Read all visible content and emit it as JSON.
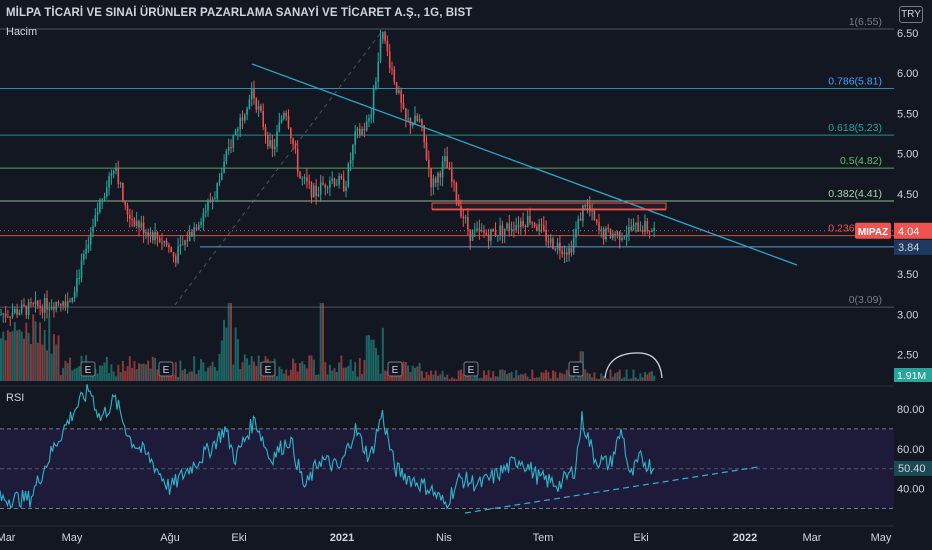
{
  "header": {
    "title": "MİLPA TİCARİ VE SINAİ ÜRÜNLER PAZARLAMA SANAYİ VE TİCARET A.Ş., 1G, BIST",
    "volume_label": "Hacim",
    "currency": "TRY"
  },
  "rsi": {
    "label": "RSI",
    "value": "50.40",
    "ticks": [
      "80.00",
      "60.00",
      "40.00"
    ]
  },
  "chart_data": {
    "type": "candlestick",
    "price_ticks": [
      "6.50",
      "6.00",
      "5.50",
      "5.00",
      "4.50",
      "4.00",
      "3.50",
      "3.00",
      "2.50"
    ],
    "x_ticks": [
      "Mar",
      "May",
      "Ağu",
      "Eki",
      "2021",
      "Nis",
      "Tem",
      "Eki",
      "2022",
      "Mar",
      "May"
    ],
    "fib_levels": [
      {
        "label": "1(6.55)",
        "value": 6.55
      },
      {
        "label": "0.786(5.81)",
        "value": 5.81
      },
      {
        "label": "0.618(5.23)",
        "value": 5.23
      },
      {
        "label": "0.5(4.82)",
        "value": 4.82
      },
      {
        "label": "0.382(4.41)",
        "value": 4.41
      },
      {
        "label": "0.236(3.98)",
        "value": 3.98
      },
      {
        "label": "0(3.09)",
        "value": 3.09
      }
    ],
    "symbol": "MIPAZ",
    "last_price": "4.04",
    "level_label": "3.84",
    "volume_last": "1.91M",
    "earnings_marker": "E"
  },
  "colors": {
    "background": "#131722",
    "up": "#26a69a",
    "down": "#ef5350",
    "trendline": "#2fa4c7",
    "rsi": "#2fb5c9",
    "rsi_band": "#1e1b3a"
  }
}
